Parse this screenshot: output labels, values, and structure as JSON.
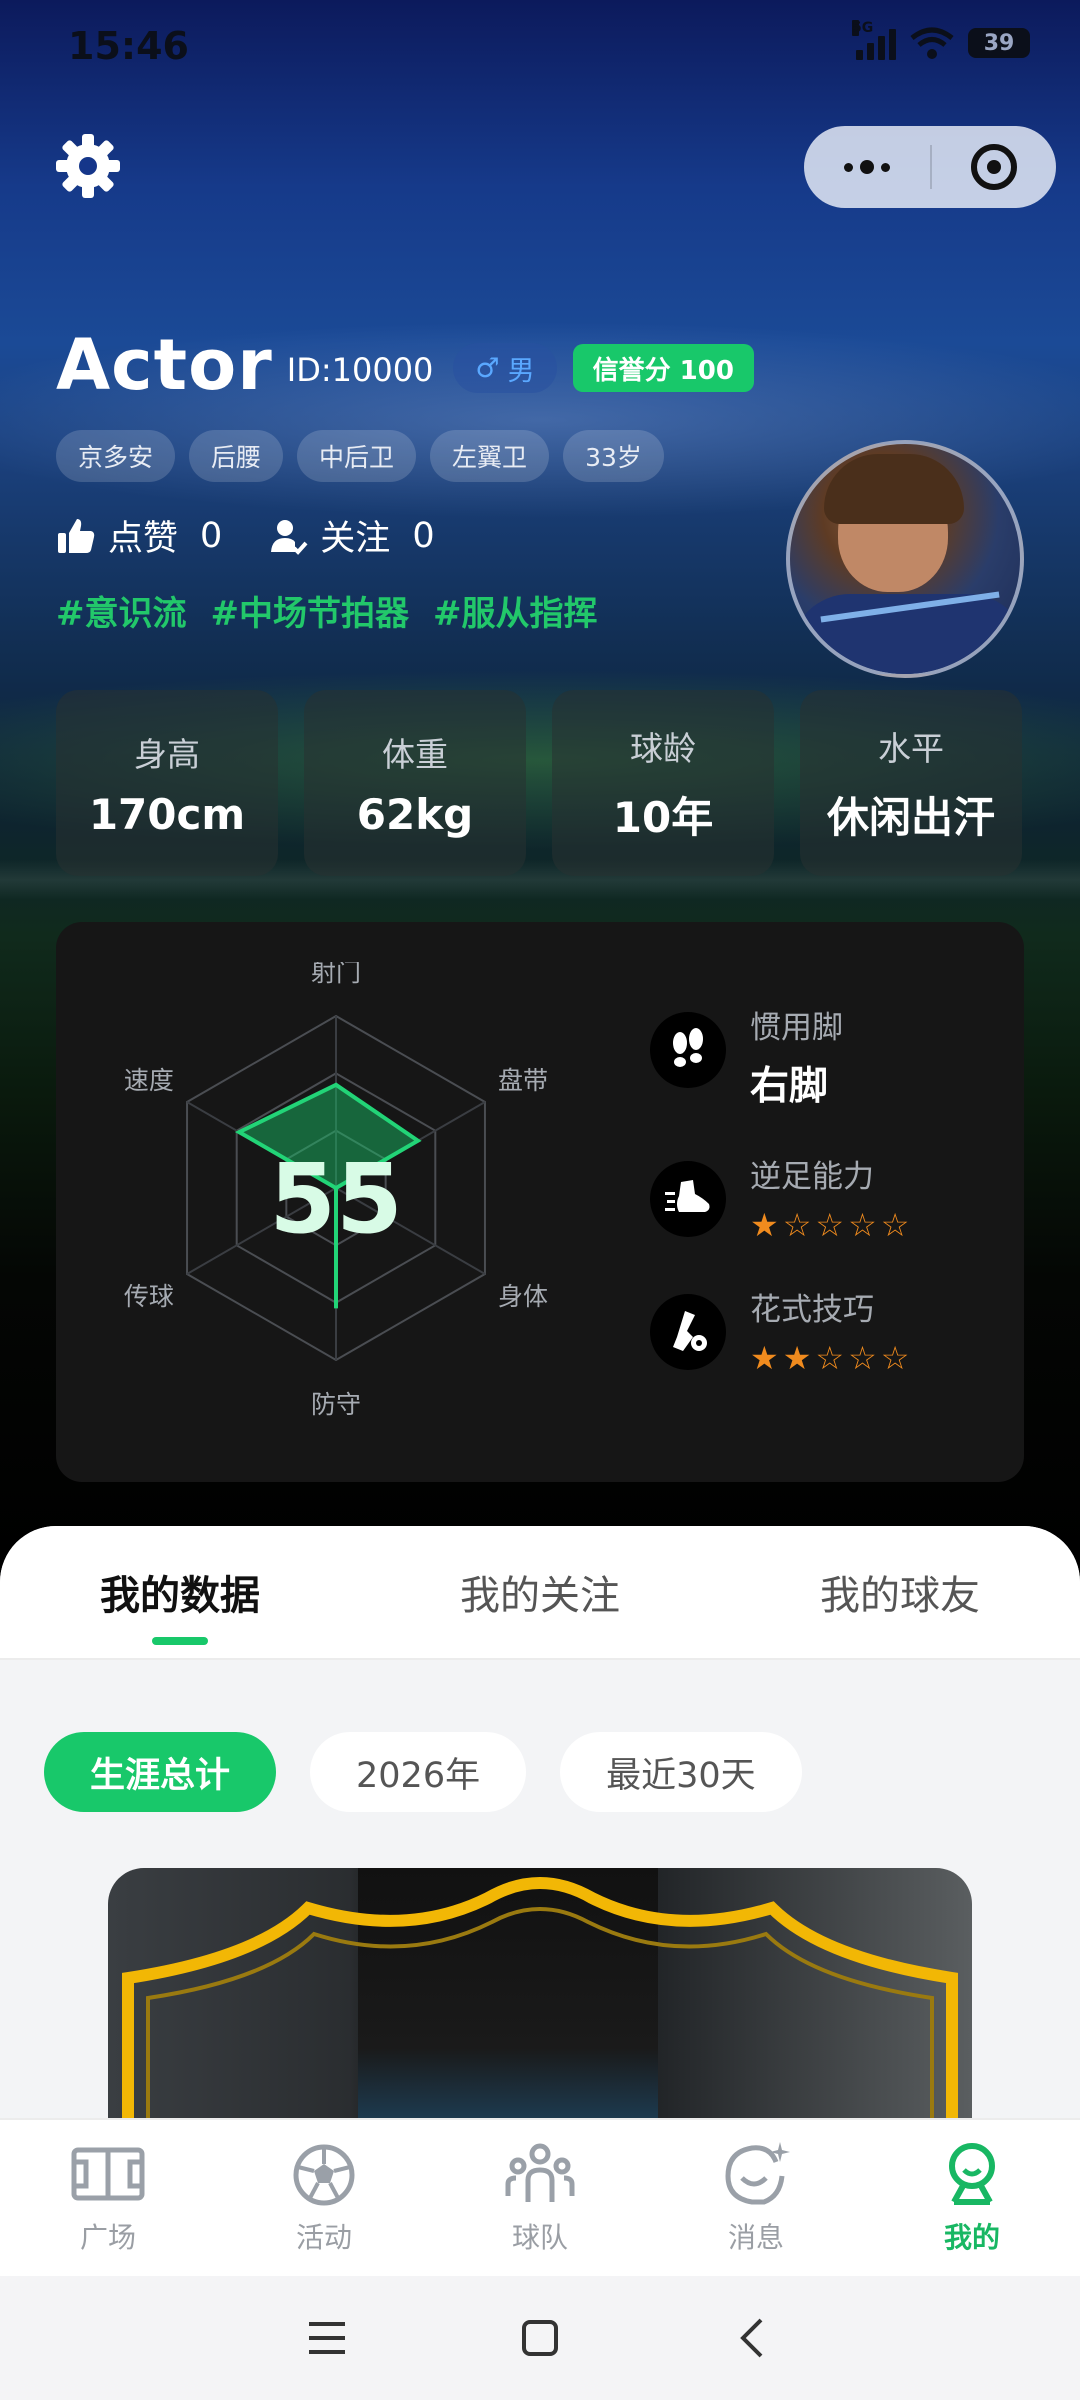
{
  "status_bar": {
    "time": "15:46",
    "network": "5G",
    "battery": "39"
  },
  "profile": {
    "name": "Actor",
    "id_text": "ID:10000",
    "gender_symbol": "♂",
    "gender": "男",
    "credit": "信誉分 100",
    "tags": [
      "京多安",
      "后腰",
      "中后卫",
      "左翼卫",
      "33岁"
    ],
    "likes_label": "点赞",
    "likes_count": "0",
    "follow_label": "关注",
    "follow_count": "0",
    "hashtags": [
      "#意识流",
      "#中场节拍器",
      "#服从指挥"
    ]
  },
  "stats": [
    {
      "label": "身高",
      "value": "170cm"
    },
    {
      "label": "体重",
      "value": "62kg"
    },
    {
      "label": "球龄",
      "value": "10年"
    },
    {
      "label": "水平",
      "value": "休闲出汗"
    }
  ],
  "ability": {
    "overall": "55",
    "axes": [
      "射门",
      "盘带",
      "身体",
      "防守",
      "传球",
      "速度"
    ],
    "axis_max": 100,
    "values": [
      60,
      55,
      0,
      70,
      0,
      65
    ]
  },
  "foot_info": [
    {
      "title": "惯用脚",
      "value": "右脚",
      "icon": "footprints-icon"
    },
    {
      "title": "逆足能力",
      "stars": 1,
      "max_stars": 5,
      "icon": "kick-shoe-icon"
    },
    {
      "title": "花式技巧",
      "stars": 2,
      "max_stars": 5,
      "icon": "freestyle-icon"
    }
  ],
  "tabs": [
    {
      "label": "我的数据",
      "active": true
    },
    {
      "label": "我的关注",
      "active": false
    },
    {
      "label": "我的球友",
      "active": false
    }
  ],
  "filters": [
    {
      "label": "生涯总计",
      "active": true
    },
    {
      "label": "2026年",
      "active": false
    },
    {
      "label": "最近30天",
      "active": false
    }
  ],
  "bottom_nav": [
    {
      "label": "广场",
      "icon": "pitch-icon",
      "active": false
    },
    {
      "label": "活动",
      "icon": "soccer-ball-icon",
      "active": false
    },
    {
      "label": "球队",
      "icon": "team-icon",
      "active": false
    },
    {
      "label": "消息",
      "icon": "message-icon",
      "active": false
    },
    {
      "label": "我的",
      "icon": "profile-icon",
      "active": true
    }
  ],
  "colors": {
    "accent": "#18c86a",
    "star": "#f08b1e",
    "gender": "#5aa8ff"
  }
}
